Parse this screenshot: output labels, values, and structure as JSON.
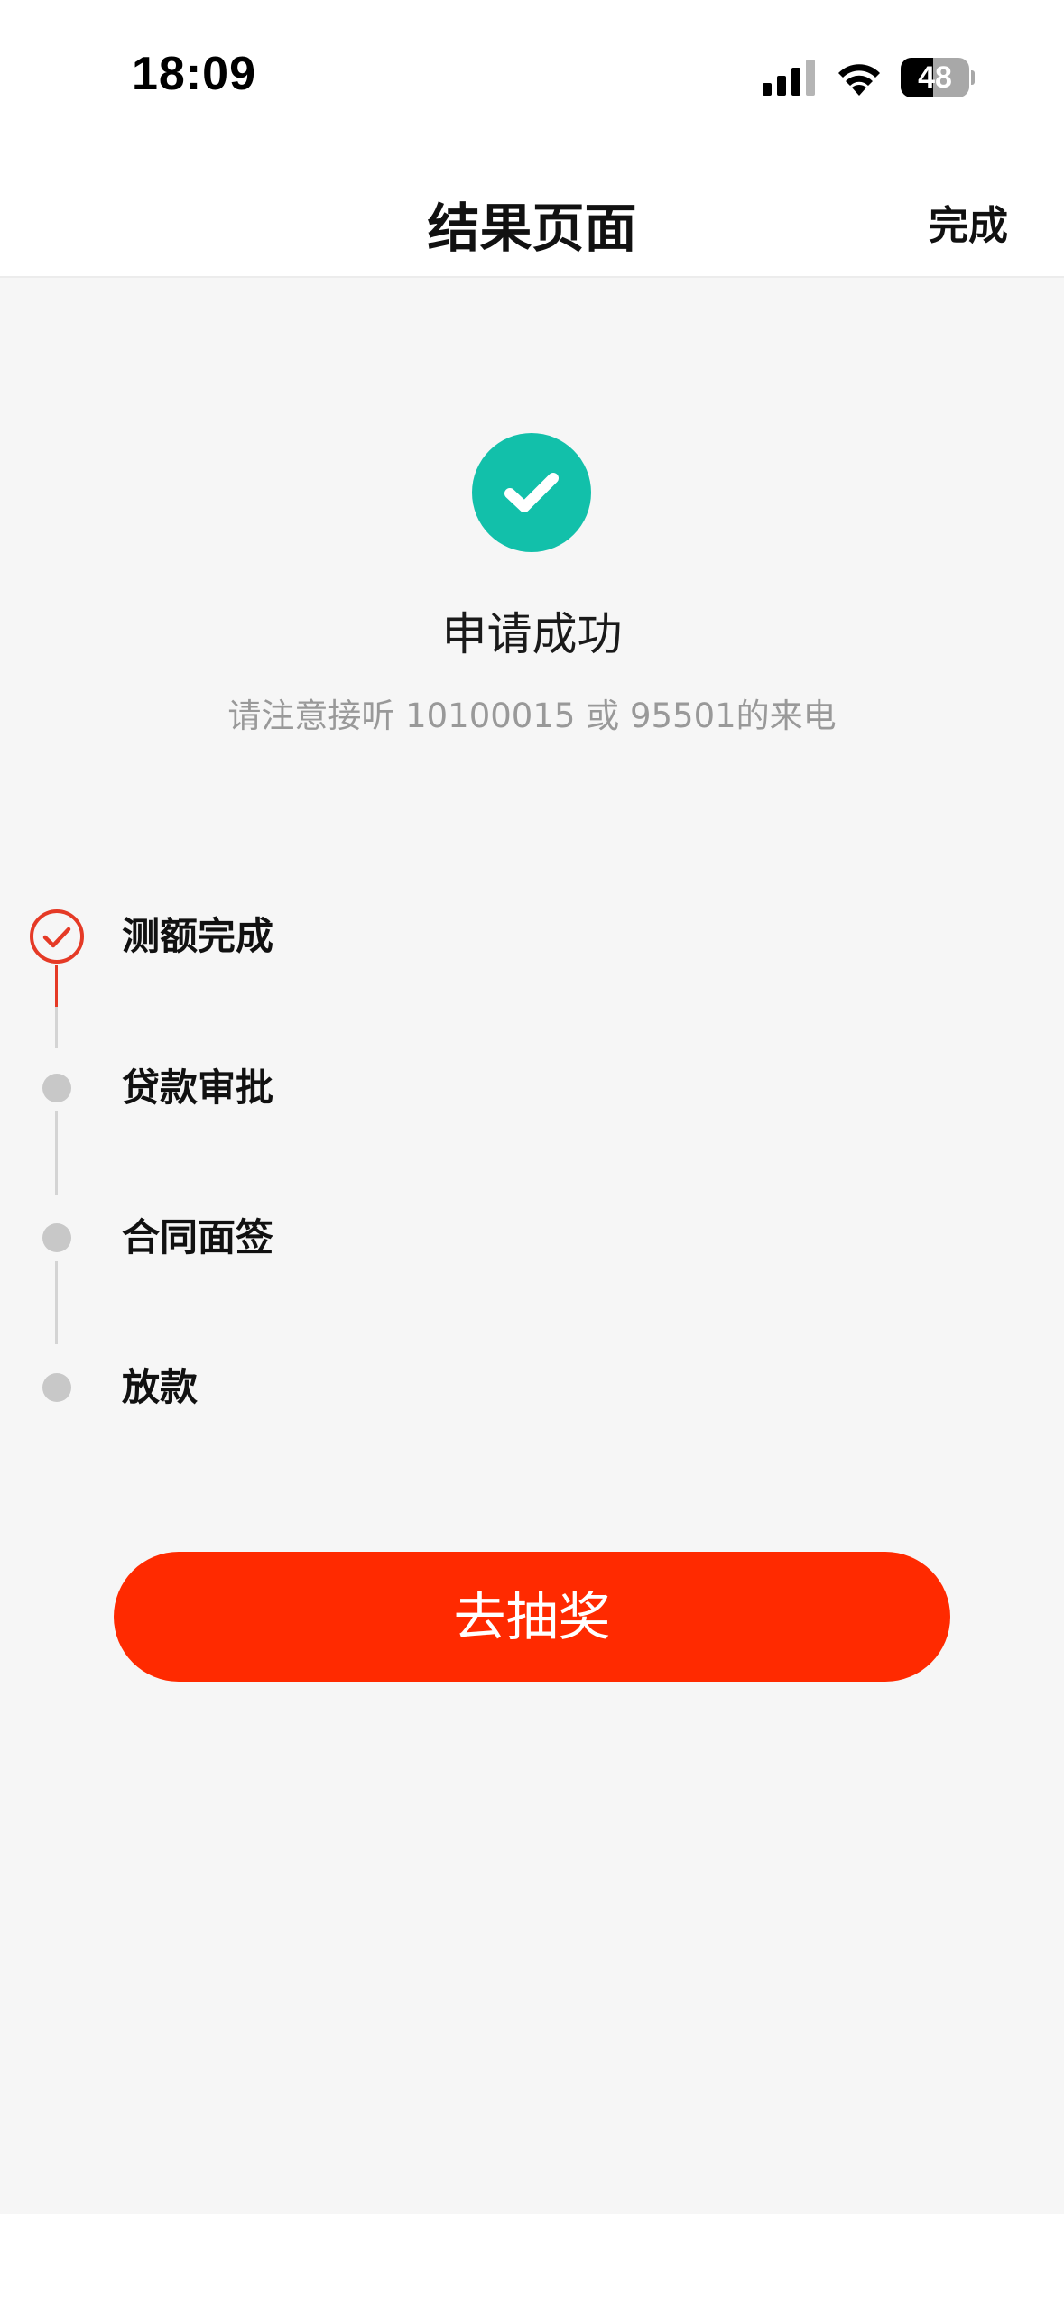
{
  "status_bar": {
    "time": "18:09",
    "battery_level": "48",
    "battery_fraction": 0.48,
    "icons": [
      "signal-icon",
      "wifi-icon",
      "battery-icon"
    ]
  },
  "nav": {
    "title": "结果页面",
    "done_label": "完成"
  },
  "result": {
    "icon": "check-icon",
    "icon_color": "#12c0aa",
    "title": "申请成功",
    "subtitle": "请注意接听 10100015 或 95501的来电"
  },
  "steps": [
    {
      "label": "测额完成",
      "status": "done"
    },
    {
      "label": "贷款审批",
      "status": "pending"
    },
    {
      "label": "合同面签",
      "status": "pending"
    },
    {
      "label": "放款",
      "status": "pending"
    }
  ],
  "action": {
    "button_label": "去抽奖",
    "button_color": "#ff2a00"
  },
  "colors": {
    "accent": "#e53a26",
    "pending_dot": "#c8c8c8",
    "background": "#f6f6f6"
  }
}
